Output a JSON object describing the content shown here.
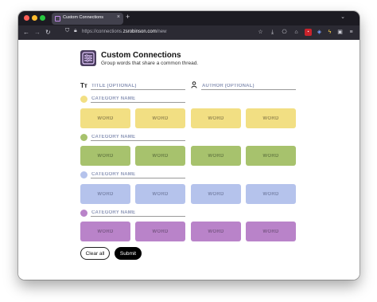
{
  "browser": {
    "tab_title": "Custom Connections",
    "tab_close": "×",
    "new_tab": "+",
    "tab_list": "⌄",
    "url_prefix": "https://connections.",
    "url_domain": "zsrobinson.com",
    "url_suffix": "/new",
    "nav": {
      "back": "←",
      "forward": "→",
      "reload": "↻"
    },
    "toolbar_icons": [
      "bookmark-star-icon",
      "download-icon",
      "extension-icon",
      "home-icon",
      "pdf-icon",
      "shield-ext-icon",
      "lightning-icon",
      "puzzle-icon",
      "menu-icon"
    ]
  },
  "app": {
    "title": "Custom Connections",
    "subtitle": "Group words that share a common thread.",
    "title_field_icon": "Tт",
    "title_placeholder": "TITLE (OPTIONAL)",
    "author_placeholder": "AUTHOR (OPTIONAL)"
  },
  "categories": [
    {
      "color": "#f2df83",
      "placeholder": "CATEGORY NAME",
      "words": [
        "WORD",
        "WORD",
        "WORD",
        "WORD"
      ]
    },
    {
      "color": "#a7c26d",
      "placeholder": "CATEGORY NAME",
      "words": [
        "WORD",
        "WORD",
        "WORD",
        "WORD"
      ]
    },
    {
      "color": "#b5c3ec",
      "placeholder": "CATEGORY NAME",
      "words": [
        "WORD",
        "WORD",
        "WORD",
        "WORD"
      ]
    },
    {
      "color": "#b983c9",
      "placeholder": "CATEGORY NAME",
      "words": [
        "WORD",
        "WORD",
        "WORD",
        "WORD"
      ]
    }
  ],
  "buttons": {
    "clear": "Clear all",
    "submit": "Submit"
  }
}
